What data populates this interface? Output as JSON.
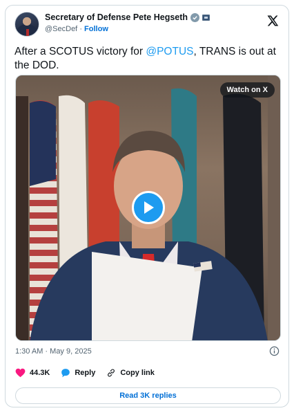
{
  "account": {
    "display_name": "Secretary of Defense Pete Hegseth",
    "handle": "@SecDef",
    "separator": "·",
    "follow_label": "Follow"
  },
  "tweet": {
    "text_before": "After a SCOTUS victory for ",
    "mention": "@POTUS",
    "text_after": ", TRANS is out at the DOD."
  },
  "media": {
    "watch_label": "Watch on X"
  },
  "meta": {
    "time": "1:30 AM",
    "separator": "·",
    "date": "May 9, 2025"
  },
  "actions": {
    "likes": "44.3K",
    "reply_label": "Reply",
    "copy_label": "Copy link"
  },
  "footer": {
    "read_replies_label": "Read 3K replies"
  },
  "colors": {
    "link": "#1d9bf0",
    "button_text": "#006fd6",
    "like": "#f91880",
    "play": "#1d9bf0"
  }
}
